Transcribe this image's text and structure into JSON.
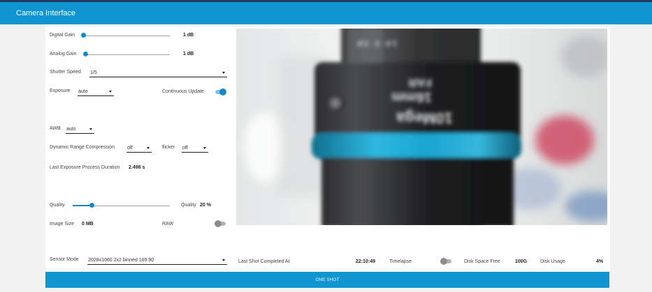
{
  "app": {
    "title": "Camera Interface"
  },
  "controls": {
    "digital_gain": {
      "label": "Digital Gain",
      "value": "1 dB",
      "fraction": 0.0
    },
    "analog_gain": {
      "label": "Analog Gain",
      "value": "1 dB",
      "fraction": 0.0
    },
    "shutter_speed": {
      "label": "Shutter Speed",
      "value": "1/5"
    },
    "exposure": {
      "label": "Exposure",
      "value": "auto"
    },
    "continuous_update": {
      "label": "Continuous Update",
      "on": true
    },
    "awb": {
      "label": "AWB",
      "value": "auto"
    },
    "drc": {
      "label": "Dynamic Range Compression",
      "value": "off"
    },
    "flicker": {
      "label": "flicker",
      "value": "off"
    },
    "last_exposure": {
      "label": "Last Exposure Process Duration",
      "value": "2.498 s"
    },
    "quality": {
      "label": "Quality",
      "value_label": "Quality",
      "value": "20 %",
      "fraction": 0.2
    },
    "image_size": {
      "label": "Image Size",
      "value": "0 MB"
    },
    "raw": {
      "label": "RAW",
      "on": false
    }
  },
  "status": {
    "sensor_mode": {
      "label": "Sensor Mode",
      "value": "2028x1080 2x2 binned 169.90"
    },
    "last_shot": {
      "label": "Last Shot Completed At",
      "value": "22:10:49"
    },
    "timelapse": {
      "label": "Timelapse",
      "on": false
    },
    "disk_free": {
      "label": "Disk Space Free",
      "value": "100G"
    },
    "disk_usage": {
      "label": "Disk Usage",
      "value": "4%"
    }
  },
  "actions": {
    "one_shot": "ONE SHOT"
  },
  "colors": {
    "primary": "#0f95d0",
    "accent": "#1588c9",
    "header_strip": "#1f3a5c"
  },
  "icons": {
    "select_caret": "caret-down-icon"
  }
}
